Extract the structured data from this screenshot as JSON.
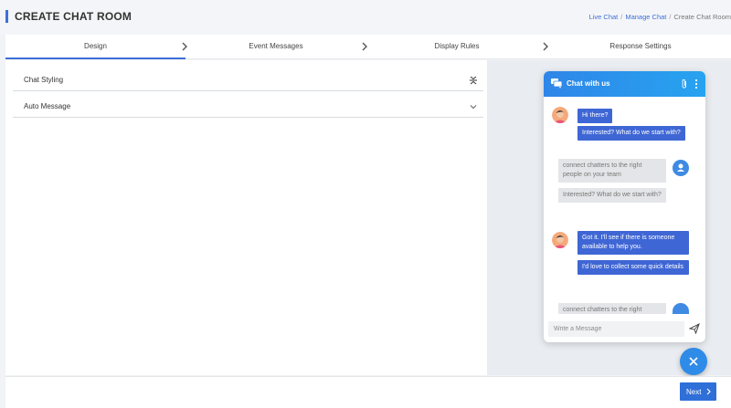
{
  "header": {
    "title": "CREATE CHAT ROOM",
    "breadcrumb": [
      {
        "label": "Live Chat"
      },
      {
        "label": "Manage Chat"
      },
      {
        "label": "Create Chat Room"
      }
    ],
    "breadcrumb_separator": "/"
  },
  "steps": [
    {
      "label": "Design",
      "active": true
    },
    {
      "label": "Event  Messages",
      "active": false
    },
    {
      "label": "Display  Rules",
      "active": false
    },
    {
      "label": "Response  Settings",
      "active": false
    }
  ],
  "accordion": [
    {
      "label": "Chat Styling",
      "icon": "collapse-icon"
    },
    {
      "label": "Auto Message",
      "icon": "chevron-down-icon"
    }
  ],
  "widget": {
    "title": "Chat with us",
    "messages": [
      {
        "from": "bot",
        "text": "Hi there?"
      },
      {
        "from": "bot",
        "text": "Interested? What do we start with?"
      },
      {
        "from": "user",
        "text": "connect chatters to the right people on your team"
      },
      {
        "from": "user",
        "text": "Interested? What do we start with?"
      },
      {
        "from": "bot",
        "text": "Got it. I'll see if there is someone available to help you."
      },
      {
        "from": "bot",
        "text": "I'd love to collect some quick details"
      },
      {
        "from": "user",
        "text": "connect chatters to the right"
      }
    ],
    "input_placeholder": "Write a Message",
    "colors": {
      "header": "#2f86e8",
      "bot_bubble": "#3f66d5",
      "user_bubble": "#e4e5e8"
    }
  },
  "footer": {
    "next_label": "Next"
  },
  "colors": {
    "accent": "#3d6fd8"
  }
}
